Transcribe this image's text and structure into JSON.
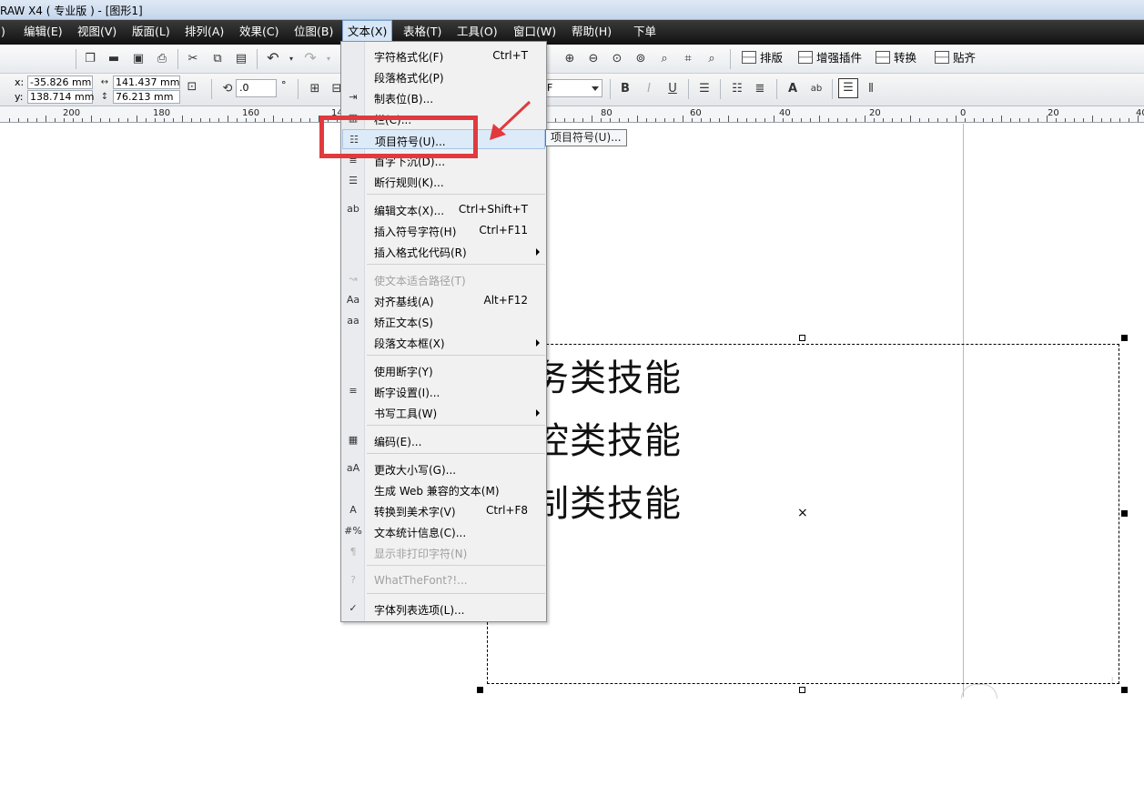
{
  "window": {
    "title": "RAW X4 ( 专业版 ) - [图形1]"
  },
  "menubar": {
    "edge_glyph": ")",
    "items": [
      {
        "label": "编辑(E)"
      },
      {
        "label": "视图(V)"
      },
      {
        "label": "版面(L)"
      },
      {
        "label": "排列(A)"
      },
      {
        "label": "效果(C)"
      },
      {
        "label": "位图(B)"
      },
      {
        "label": "文本(X)"
      },
      {
        "label": "表格(T)"
      },
      {
        "label": "工具(O)"
      },
      {
        "label": "窗口(W)"
      },
      {
        "label": "帮助(H)"
      },
      {
        "label": "下单"
      }
    ],
    "active": "文本(X)"
  },
  "toolbar": {
    "buttons": [
      {
        "label": "排版"
      },
      {
        "label": "增强插件"
      },
      {
        "label": "转换"
      },
      {
        "label": "贴齐"
      }
    ]
  },
  "property_bar": {
    "x_label": "x:",
    "x_value": "-35.826 mm",
    "y_label": "y:",
    "y_value": "138.714 mm",
    "width_value": "141.437 mm",
    "height_value": "76.213 mm",
    "rotation_value": ".0",
    "rotation_unit": "°",
    "font_size_value": "F"
  },
  "ruler": {
    "labels": [
      "200",
      "180",
      "160",
      "14",
      "80",
      "60",
      "40",
      "20",
      "0",
      "20",
      "40"
    ]
  },
  "canvas": {
    "text_lines": [
      "务类技能",
      "控类技能",
      "制类技能"
    ]
  },
  "text_menu": {
    "items": [
      {
        "label": "字符格式化(F)",
        "shortcut": "Ctrl+T",
        "icon": "",
        "disabled": false,
        "submenu": false
      },
      {
        "label": "段落格式化(P)",
        "shortcut": "",
        "icon": "",
        "disabled": false,
        "submenu": false
      },
      {
        "label": "制表位(B)...",
        "shortcut": "",
        "icon": "tab-icon",
        "disabled": false,
        "submenu": false
      },
      {
        "label": "栏(C)...",
        "shortcut": "",
        "icon": "columns-icon",
        "disabled": false,
        "submenu": false
      },
      {
        "label": "项目符号(U)...",
        "shortcut": "",
        "icon": "bullets-icon",
        "disabled": false,
        "submenu": false
      },
      {
        "label": "首字下沉(D)...",
        "shortcut": "",
        "icon": "drop-cap-icon",
        "disabled": false,
        "submenu": false
      },
      {
        "label": "断行规则(K)...",
        "shortcut": "",
        "icon": "line-break-icon",
        "disabled": false,
        "submenu": false
      },
      {
        "label": "编辑文本(X)...",
        "shortcut": "Ctrl+Shift+T",
        "icon": "edit-text-icon",
        "disabled": false,
        "submenu": false
      },
      {
        "label": "插入符号字符(H)",
        "shortcut": "Ctrl+F11",
        "icon": "",
        "disabled": false,
        "submenu": false
      },
      {
        "label": "插入格式化代码(R)",
        "shortcut": "",
        "icon": "",
        "disabled": false,
        "submenu": true
      },
      {
        "label": "使文本适合路径(T)",
        "shortcut": "",
        "icon": "fit-path-icon",
        "disabled": true,
        "submenu": false
      },
      {
        "label": "对齐基线(A)",
        "shortcut": "Alt+F12",
        "icon": "align-baseline-icon",
        "disabled": false,
        "submenu": false
      },
      {
        "label": "矫正文本(S)",
        "shortcut": "",
        "icon": "straighten-text-icon",
        "disabled": false,
        "submenu": false
      },
      {
        "label": "段落文本框(X)",
        "shortcut": "",
        "icon": "",
        "disabled": false,
        "submenu": true
      },
      {
        "label": "使用断字(Y)",
        "shortcut": "",
        "icon": "",
        "disabled": false,
        "submenu": false
      },
      {
        "label": "断字设置(I)...",
        "shortcut": "",
        "icon": "hyphen-settings-icon",
        "disabled": false,
        "submenu": false
      },
      {
        "label": "书写工具(W)",
        "shortcut": "",
        "icon": "",
        "disabled": false,
        "submenu": true
      },
      {
        "label": "编码(E)...",
        "shortcut": "",
        "icon": "encoding-icon",
        "disabled": false,
        "submenu": false
      },
      {
        "label": "更改大小写(G)...",
        "shortcut": "",
        "icon": "change-case-icon",
        "disabled": false,
        "submenu": false
      },
      {
        "label": "生成 Web 兼容的文本(M)",
        "shortcut": "",
        "icon": "",
        "disabled": false,
        "submenu": false
      },
      {
        "label": "转换到美术字(V)",
        "shortcut": "Ctrl+F8",
        "icon": "convert-artistic-icon",
        "disabled": false,
        "submenu": false
      },
      {
        "label": "文本统计信息(C)...",
        "shortcut": "",
        "icon": "text-stats-icon",
        "disabled": false,
        "submenu": false
      },
      {
        "label": "显示非打印字符(N)",
        "shortcut": "",
        "icon": "pilcrow-icon",
        "disabled": true,
        "submenu": false
      },
      {
        "label": "WhatTheFont?!...",
        "shortcut": "",
        "icon": "whatthefont-icon",
        "disabled": true,
        "submenu": false
      },
      {
        "label": "字体列表选项(L)...",
        "shortcut": "",
        "icon": "font-list-icon",
        "disabled": false,
        "submenu": false
      }
    ],
    "highlighted": "项目符号(U)..."
  },
  "tooltip": {
    "text": "项目符号(U)..."
  },
  "colors": {
    "annotation_red": "#e03a3e",
    "menu_highlight": "#ddeaf8"
  }
}
